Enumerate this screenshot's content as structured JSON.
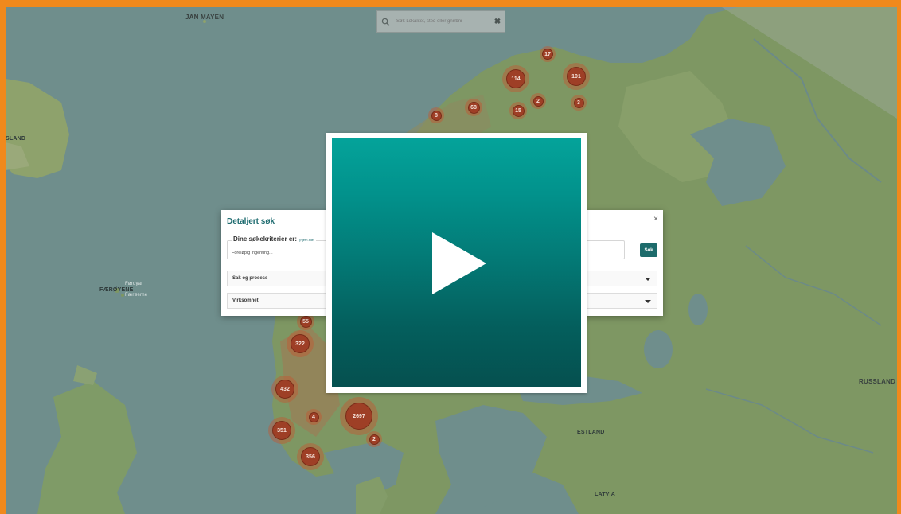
{
  "map": {
    "places": {
      "jan_mayen": "JAN MAYEN",
      "island": "SLAND",
      "faeroyene": "FÆRØYENE",
      "faeroyene_sub1": "Føroyar",
      "faeroyene_sub2": "Færøerne",
      "russland": "RUSSLAND",
      "estland": "ESTLAND",
      "latvia": "LATVIA"
    },
    "clusters": [
      {
        "label": "17"
      },
      {
        "label": "114"
      },
      {
        "label": "101"
      },
      {
        "label": "68"
      },
      {
        "label": "15"
      },
      {
        "label": "2"
      },
      {
        "label": "3"
      },
      {
        "label": "8"
      },
      {
        "label": "55"
      },
      {
        "label": "322"
      },
      {
        "label": "432"
      },
      {
        "label": "4"
      },
      {
        "label": "2697"
      },
      {
        "label": "351"
      },
      {
        "label": "2"
      },
      {
        "label": "356"
      }
    ]
  },
  "search": {
    "placeholder": "Søk Lokalitet, sted eller gnr/bnr",
    "clear_symbol": "✖"
  },
  "dialog": {
    "title": "Detaljert søk",
    "close_symbol": "×",
    "criteria_legend": "Dine søkekriterier er:",
    "criteria_clear": "(Fjern alle)",
    "criteria_empty": "Foreløpig ingenting...",
    "search_button": "Søk",
    "sections": [
      {
        "label": "Sak og prosess"
      },
      {
        "label": "Virksomhet"
      }
    ]
  },
  "colors": {
    "frame": "#f0891c",
    "accent": "#1d6b6b",
    "cluster": "#9e3f26",
    "video_top": "#04a39a",
    "video_bottom": "#05504f"
  },
  "icons": {
    "search": "search-icon",
    "play": "play-icon",
    "close": "close-icon",
    "caret": "chevron-down-icon"
  }
}
